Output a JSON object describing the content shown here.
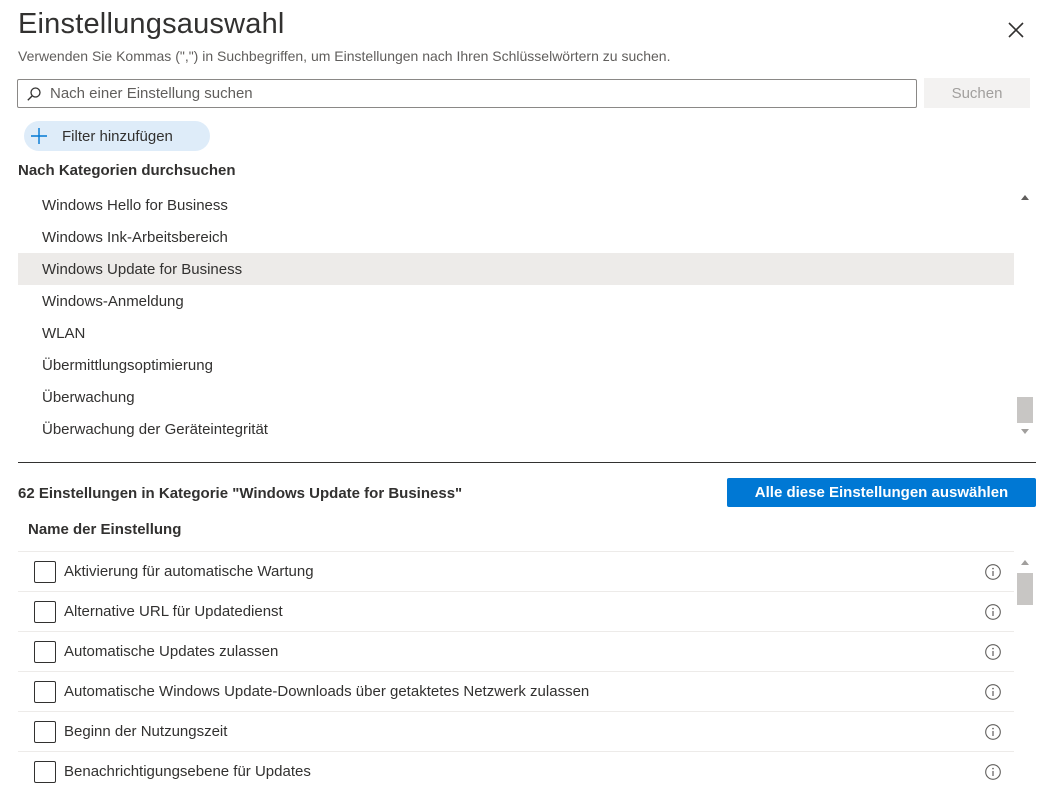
{
  "header": {
    "title": "Einstellungsauswahl",
    "subtitle": "Verwenden Sie Kommas (\",\") in Suchbegriffen, um Einstellungen nach Ihren Schlüsselwörtern zu suchen."
  },
  "search": {
    "placeholder": "Nach einer Einstellung suchen",
    "value": "",
    "button_label": "Suchen"
  },
  "filter": {
    "label": "Filter hinzufügen"
  },
  "categories": {
    "heading": "Nach Kategorien durchsuchen",
    "selected": "Windows Update for Business",
    "items": [
      "Windows Hello for Business",
      "Windows Ink-Arbeitsbereich",
      "Windows Update for Business",
      "Windows-Anmeldung",
      "WLAN",
      "Übermittlungsoptimierung",
      "Überwachung",
      "Überwachung der Geräteintegrität"
    ]
  },
  "settings": {
    "count_heading": "62 Einstellungen in Kategorie \"Windows Update for Business\"",
    "select_all_label": "Alle diese Einstellungen auswählen",
    "column_header": "Name der Einstellung",
    "rows": [
      "Aktivierung für automatische Wartung",
      "Alternative URL für Updatedienst",
      "Automatische Updates zulassen",
      "Automatische Windows Update-Downloads über getaktetes Netzwerk zulassen",
      "Beginn der Nutzungszeit",
      "Benachrichtigungsebene für Updates"
    ]
  },
  "colors": {
    "accent": "#0078d4",
    "pill_background": "#deecf9",
    "selected_row": "#edebe9"
  },
  "icons": {
    "close": "close-icon",
    "search": "search-icon",
    "add": "plus-icon",
    "info": "info-icon"
  }
}
